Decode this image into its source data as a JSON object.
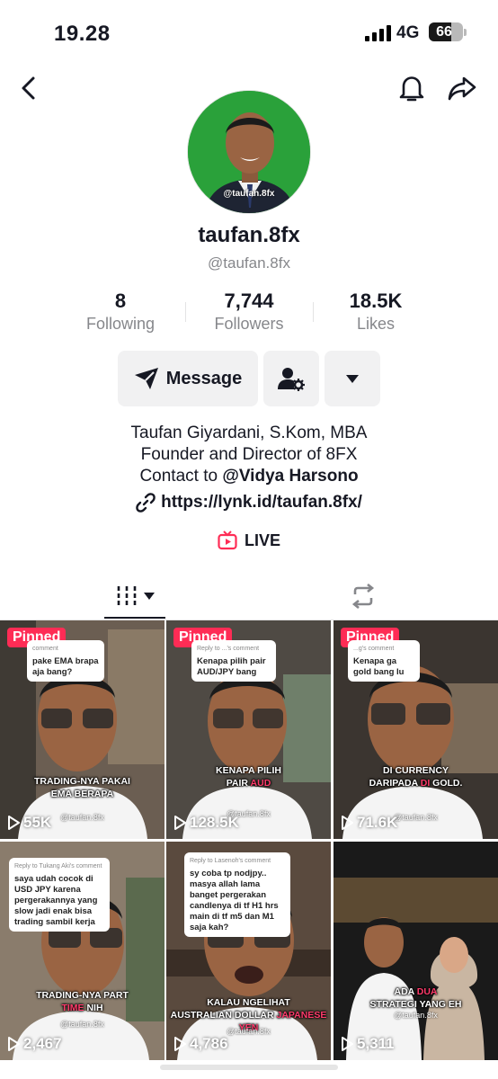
{
  "status_bar": {
    "time": "19.28",
    "network": "4G",
    "battery": "66",
    "battery_level": 0.66
  },
  "profile": {
    "avatar_handle": "@taufan.8fx",
    "name": "taufan.8fx",
    "handle": "@taufan.8fx"
  },
  "stats": [
    {
      "value": "8",
      "label": "Following"
    },
    {
      "value": "7,744",
      "label": "Followers"
    },
    {
      "value": "18.5K",
      "label": "Likes"
    }
  ],
  "actions": {
    "message_label": "Message"
  },
  "bio": {
    "line1": "Taufan Giyardani, S.Kom, MBA",
    "line2": "Founder and Director of 8FX",
    "line3_prefix": "Contact to ",
    "line3_mention": "@Vidya Harsono",
    "link": "https://lynk.id/taufan.8fx/",
    "live_label": "LIVE"
  },
  "colors": {
    "accent": "#fe2c55",
    "text": "#161823",
    "muted": "#86878b",
    "button_bg": "#f1f1f2"
  },
  "videos": [
    {
      "pinned": "Pinned",
      "comment_header": "comment",
      "comment": "pake EMA brapa aja bang?",
      "caption_a": "TRADING-NYA",
      "caption_b": " PAKAI",
      "caption_c": "EMA BERAPA",
      "watermark": "@taufan.8fx",
      "views": "55K"
    },
    {
      "pinned": "Pinned",
      "comment_header": "Reply to ...'s comment",
      "comment": "Kenapa pilih pair AUD/JPY bang",
      "caption_a": "KENAPA PILIH",
      "caption_b": "PAIR ",
      "caption_c": "AUD",
      "watermark": "@taufan.8fx",
      "views": "128.5K"
    },
    {
      "pinned": "Pinned",
      "comment_header": "...g's comment",
      "comment": "Kenapa ga gold bang lu",
      "caption_a": "DI CURRENCY",
      "caption_b": "DARIPADA ",
      "caption_c": "DI",
      "caption_d": " GOLD.",
      "watermark": "@taufan.8fx",
      "views": "71.6K"
    },
    {
      "comment_header": "Reply to Tukang Aki's comment",
      "comment": "saya udah cocok di USD JPY karena pergerakannya yang slow jadi enak bisa trading sambil kerja",
      "caption_a": "TRADING-NYA PART",
      "caption_b": "TIME",
      "caption_c": " NIH",
      "watermark": "@taufan.8fx",
      "views": "2,467"
    },
    {
      "comment_header": "Reply to Lasenoh's comment",
      "comment": "sy coba tp nodjpy.. masya allah lama banget pergerakan candlenya di tf H1 hrs main di tf m5 dan M1 saja kah?",
      "caption_a": "KALAU NGELIHAT",
      "caption_b": "AUSTRALIAN DOLLAR ",
      "caption_c": "JAPANESE YEN",
      "watermark": "@taufan.8fx",
      "views": "4,786"
    },
    {
      "caption_a": "ADA ",
      "caption_b": "DUA",
      "caption_c": "STRATEGI YANG EH",
      "watermark": "@taufan.8fx",
      "views": "5,311"
    }
  ]
}
